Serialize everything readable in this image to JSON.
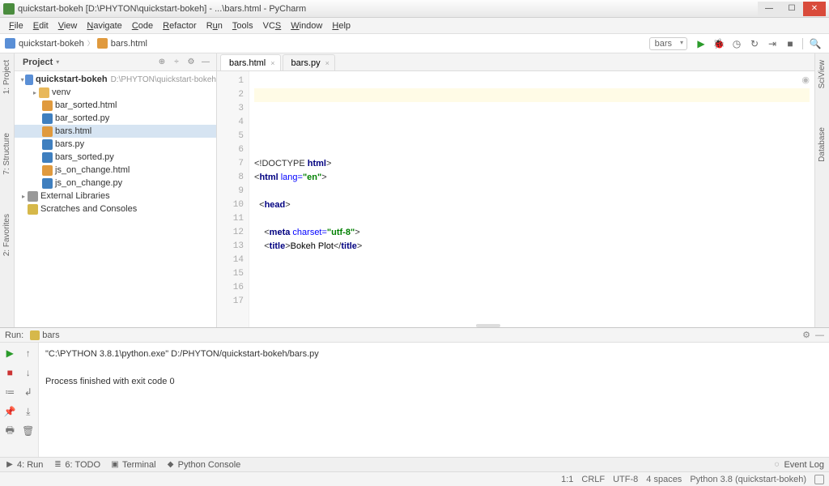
{
  "window": {
    "title": "quickstart-bokeh [D:\\PHYTON\\quickstart-bokeh] - ...\\bars.html - PyCharm"
  },
  "menu": [
    "File",
    "Edit",
    "View",
    "Navigate",
    "Code",
    "Refactor",
    "Run",
    "Tools",
    "VCS",
    "Window",
    "Help"
  ],
  "breadcrumb": {
    "root": "quickstart-bokeh",
    "file": "bars.html"
  },
  "runcfg": {
    "selected": "bars"
  },
  "project": {
    "label": "Project",
    "root": {
      "name": "quickstart-bokeh",
      "path": "D:\\PHYTON\\quickstart-bokeh"
    },
    "venv": "venv",
    "files": [
      "bar_sorted.html",
      "bar_sorted.py",
      "bars.html",
      "bars.py",
      "bars_sorted.py",
      "js_on_change.html",
      "js_on_change.py"
    ],
    "extlib": "External Libraries",
    "scratches": "Scratches and Consoles"
  },
  "tabs": [
    {
      "name": "bars.html",
      "kind": "html",
      "active": true
    },
    {
      "name": "bars.py",
      "kind": "py",
      "active": false
    }
  ],
  "editor": {
    "lines": [
      1,
      2,
      3,
      4,
      5,
      6,
      7,
      8,
      9,
      10,
      11,
      12,
      13,
      14,
      15,
      16,
      17
    ],
    "l5_pre": "<!DOCTYPE ",
    "l5_tag": "html",
    "l5_post": ">",
    "l6_a": "<",
    "l6_tag": "html",
    "l6_attr": " lang=",
    "l6_str": "\"en\"",
    "l6_c": ">",
    "l8_a": "<",
    "l8_tag": "head",
    "l8_c": ">",
    "l10_a": "<",
    "l10_tag": "meta",
    "l10_attr": " charset=",
    "l10_str": "\"utf-8\"",
    "l10_c": ">",
    "l11_a": "<",
    "l11_tag": "title",
    "l11_b": ">",
    "l11_txt": "Bokeh Plot",
    "l11_c": "</",
    "l11_tag2": "title",
    "l11_d": ">"
  },
  "run": {
    "label": "Run:",
    "cfg": "bars",
    "line1": "\"C:\\PYTHON 3.8.1\\python.exe\" D:/PHYTON/quickstart-bokeh/bars.py",
    "line2": "Process finished with exit code 0"
  },
  "bottom": {
    "run": "4: Run",
    "todo": "6: TODO",
    "terminal": "Terminal",
    "pycon": "Python Console",
    "eventlog": "Event Log"
  },
  "sidetabs": {
    "left1": "1: Project",
    "left2": "7: Structure",
    "left3": "2: Favorites",
    "right1": "SciView",
    "right2": "Database"
  },
  "status": {
    "pos": "1:1",
    "le": "CRLF",
    "enc": "UTF-8",
    "indent": "4 spaces",
    "sdk": "Python 3.8 (quickstart-bokeh)"
  }
}
